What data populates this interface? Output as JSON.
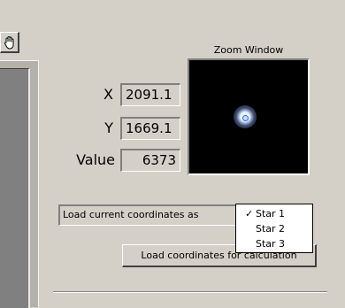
{
  "toolbar": {
    "hand_tool_icon": "hand-pan-icon"
  },
  "zoom": {
    "title": "Zoom Window"
  },
  "readouts": {
    "x_label": "X",
    "x_value": "2091.1",
    "y_label": "Y",
    "y_value": "1669.1",
    "value_label": "Value",
    "value_value": "6373"
  },
  "load": {
    "label": "Load current coordinates as",
    "button_label": "Load coordinates for calculation",
    "menu_items": [
      {
        "label": "Star 1",
        "checked": true,
        "check": "✓"
      },
      {
        "label": "Star 2",
        "checked": false,
        "check": ""
      },
      {
        "label": "Star 3",
        "checked": false,
        "check": ""
      }
    ]
  },
  "colors": {
    "panel": "#d4d0c8",
    "zoom_bg": "#000000",
    "star_marker": "#2a6bff"
  }
}
